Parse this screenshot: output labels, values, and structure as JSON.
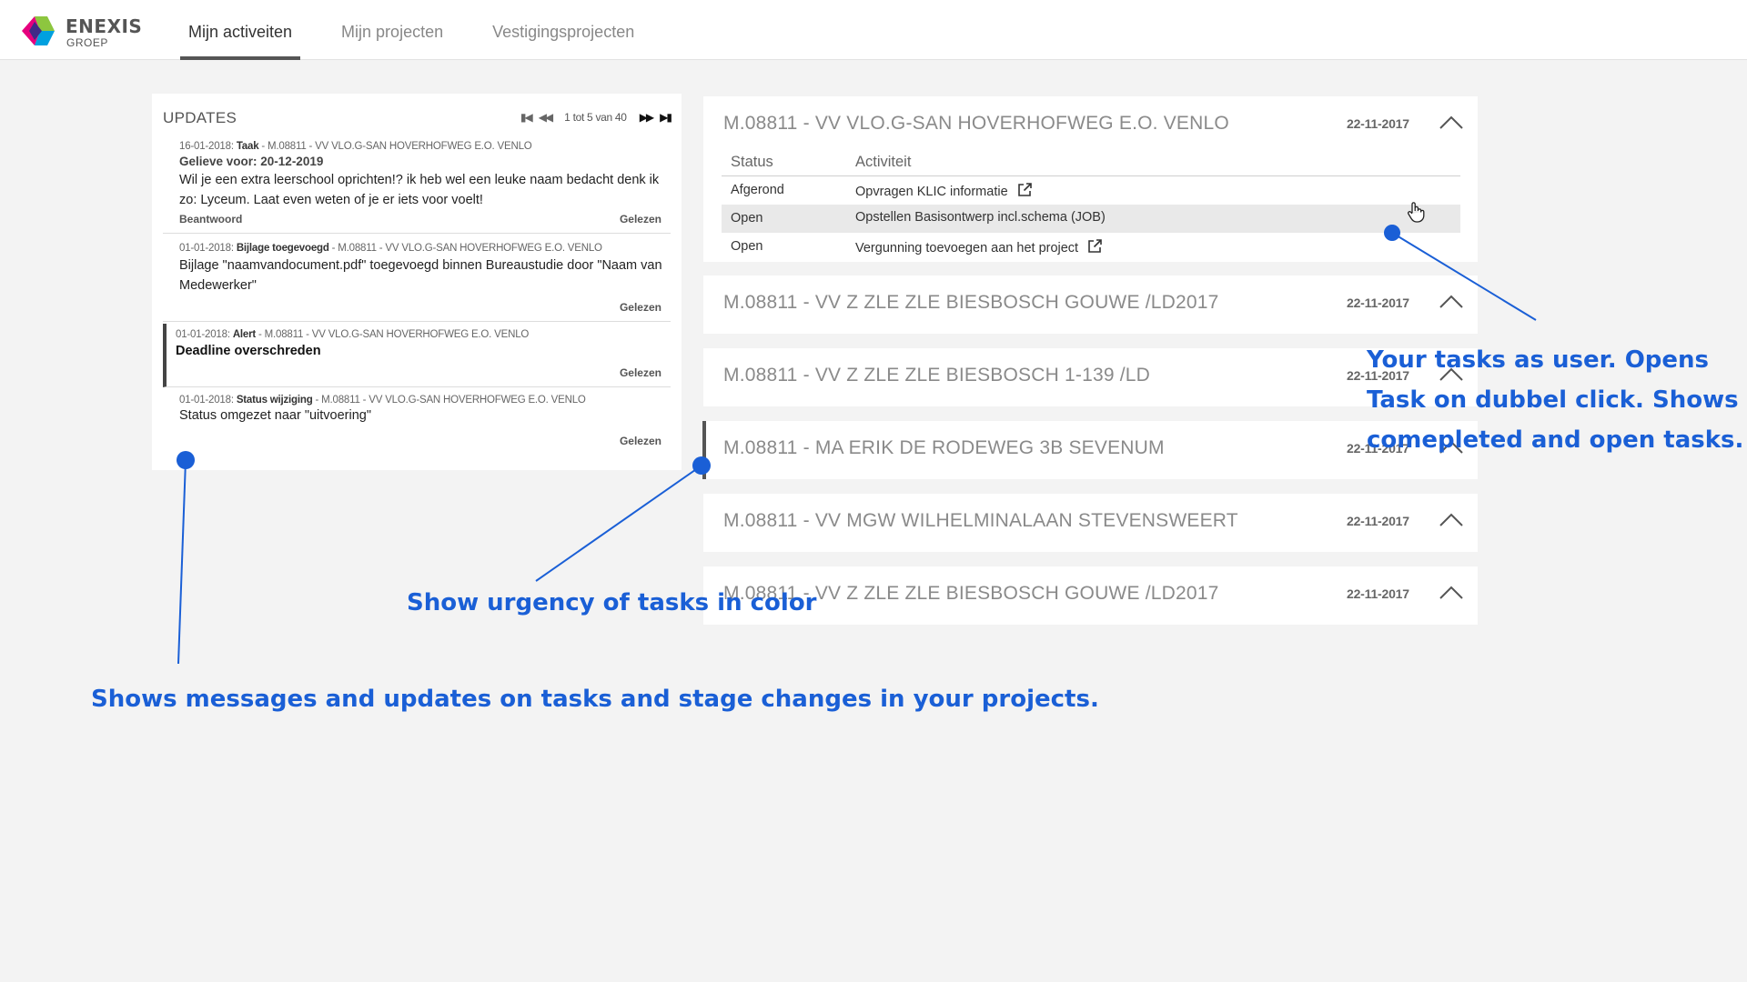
{
  "brand": {
    "name": "ENEXIS",
    "sub": "GROEP",
    "colors": [
      "#e6007e",
      "#8dc63f",
      "#00a0df",
      "#3f2a87"
    ]
  },
  "nav": {
    "tabs": [
      {
        "label": "Mijn activeiten",
        "active": true
      },
      {
        "label": "Mijn projecten",
        "active": false
      },
      {
        "label": "Vestigingsprojecten",
        "active": false
      }
    ]
  },
  "updates": {
    "title": "UPDATES",
    "pager": {
      "count": "1 tot 5 van 40"
    },
    "items": [
      {
        "date": "16-01-2018:",
        "type": "Taak",
        "project": " - M.08811 - VV VLO.G-SAN HOVERHOFWEG E.O. VENLO",
        "deadline": "Gelieve voor: 20-12-2019",
        "body": "Wil je een extra leerschool oprichten!? ik heb wel een leuke naam bedacht denk ik zo: Lyceum.  Laat even weten of je er iets voor voelt!",
        "reply": "Beantwoord",
        "read": "Gelezen"
      },
      {
        "date": "01-01-2018:",
        "type": "Bijlage toegevoegd",
        "project": " - M.08811 - VV VLO.G-SAN HOVERHOFWEG E.O. VENLO",
        "body": "Bijlage \"naamvandocument.pdf\" toegevoegd binnen Bureaustudie door \"Naam van Medewerker\"",
        "read": "Gelezen"
      },
      {
        "date": "01-01-2018:",
        "type": "Alert",
        "project": " - M.08811 - VV VLO.G-SAN HOVERHOFWEG E.O. VENLO",
        "body": "Deadline overschreden",
        "read": "Gelezen"
      },
      {
        "date": "01-01-2018:",
        "type": "Status wijziging",
        "project": " - M.08811 - VV VLO.G-SAN HOVERHOFWEG E.O. VENLO",
        "body": "Status omgezet naar \"uitvoering\"",
        "read": "Gelezen"
      }
    ]
  },
  "projects": [
    {
      "title": "M.08811 - VV VLO.G-SAN HOVERHOFWEG E.O. VENLO",
      "date": "22-11-2017",
      "columns": {
        "status": "Status",
        "activity": "Activiteit"
      },
      "activities": [
        {
          "status": "Afgerond",
          "activity": "Opvragen KLIC informatie",
          "external": true
        },
        {
          "status": "Open",
          "activity": "Opstellen Basisontwerp incl.schema (JOB)",
          "external": false
        },
        {
          "status": "Open",
          "activity": "Vergunning toevoegen aan het project",
          "external": true
        }
      ]
    },
    {
      "title": "M.08811 - VV Z ZLE ZLE BIESBOSCH GOUWE /LD2017",
      "date": "22-11-2017"
    },
    {
      "title": "M.08811 - VV Z ZLE ZLE BIESBOSCH 1-139 /LD",
      "date": "22-11-2017"
    },
    {
      "title": "M.08811 - MA ERIK DE RODEWEG 3B SEVENUM",
      "date": "22-11-2017"
    },
    {
      "title": "M.08811 - VV MGW WILHELMINALAAN STEVENSWEERT",
      "date": "22-11-2017"
    },
    {
      "title": "M.08811 - VV Z ZLE ZLE BIESBOSCH GOUWE /LD2017",
      "date": "22-11-2017"
    }
  ],
  "annotations": {
    "tasks": [
      "Your tasks as user. Opens",
      "Task on dubbel click. Shows",
      "comepleted and open tasks."
    ],
    "urgency": "Show urgency of tasks in color",
    "messages": "Shows messages and updates on tasks and stage changes in your projects.",
    "color": "#1a5fd6"
  }
}
